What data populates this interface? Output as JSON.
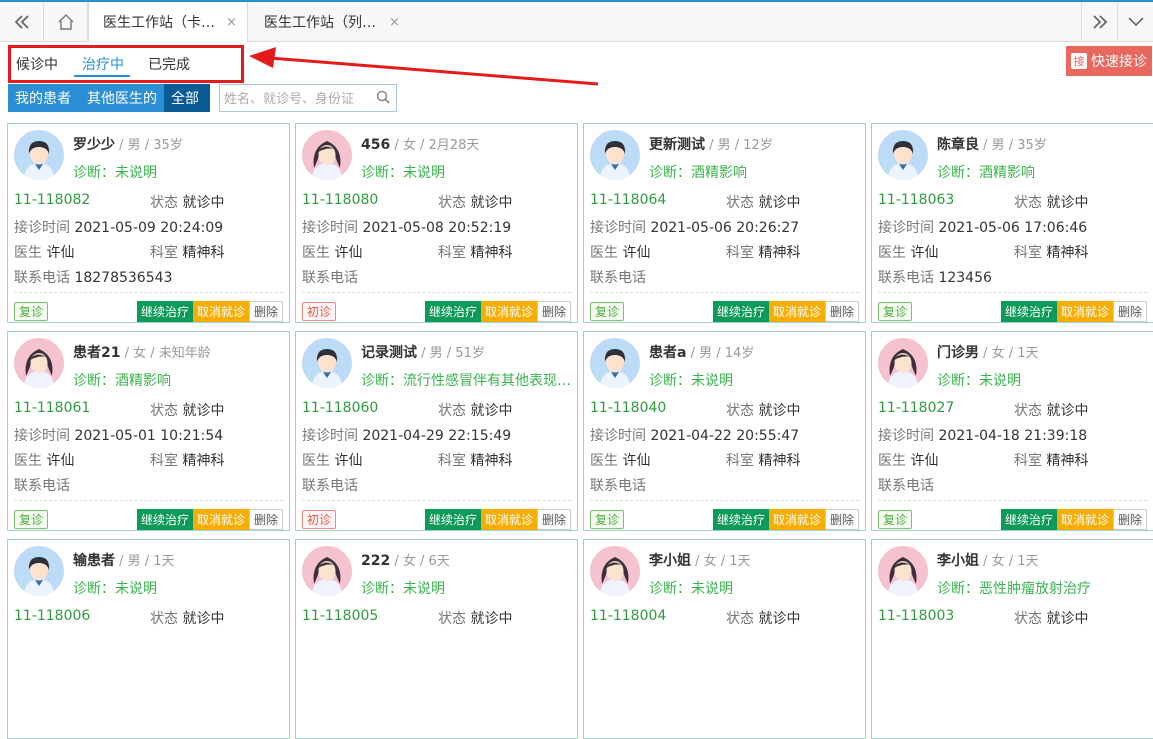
{
  "topbar": {
    "back_icon": "double-chevron-left-icon",
    "home_icon": "home-icon",
    "tabs": [
      {
        "label": "医生工作站（卡…",
        "close": "×"
      },
      {
        "label": "医生工作站（列…",
        "close": "×"
      }
    ],
    "forward_icon": "double-chevron-right-icon",
    "menu_icon": "chevron-down-icon"
  },
  "status_tabs": [
    "候诊中",
    "治疗中",
    "已完成"
  ],
  "active_status": "治疗中",
  "quick_button": {
    "icon_char": "接",
    "label": "快速接诊"
  },
  "filters": [
    "我的患者",
    "其他医生的",
    "全部"
  ],
  "search": {
    "placeholder": "姓名、就诊号、身份证",
    "value": ""
  },
  "labels": {
    "status": "状态",
    "time": "接诊时间",
    "doctor": "医生",
    "dept": "科室",
    "phone": "联系电话",
    "continue": "继续治疗",
    "cancel": "取消就诊",
    "delete": "删除"
  },
  "colors": {
    "accent": "#2b8fd6",
    "continue": "#0b9a58",
    "cancel": "#f6ad05",
    "quick": "#e9685e",
    "highlight": "#e51b1b"
  },
  "patients": [
    {
      "name": "罗少少",
      "meta": " / 男 / 35岁",
      "gender": "male",
      "diag": "诊断：未说明",
      "id": "11-118082",
      "status": "就诊中",
      "time": "2021-05-09 20:24:09",
      "doctor": "许仙",
      "dept": "精神科",
      "phone": "18278536543",
      "badge": "复诊",
      "badge_type": "fu"
    },
    {
      "name": "456",
      "meta": " / 女 / 2月28天",
      "gender": "female",
      "diag": "诊断：未说明",
      "id": "11-118080",
      "status": "就诊中",
      "time": "2021-05-08 20:52:19",
      "doctor": "许仙",
      "dept": "精神科",
      "phone": "",
      "badge": "初诊",
      "badge_type": "chu"
    },
    {
      "name": "更新测试",
      "meta": " / 男 / 12岁",
      "gender": "male",
      "diag": "诊断：酒精影响",
      "id": "11-118064",
      "status": "就诊中",
      "time": "2021-05-06 20:26:27",
      "doctor": "许仙",
      "dept": "精神科",
      "phone": "",
      "badge": "复诊",
      "badge_type": "fu"
    },
    {
      "name": "陈章良",
      "meta": " / 男 / 35岁",
      "gender": "male",
      "diag": "诊断：酒精影响",
      "id": "11-118063",
      "status": "就诊中",
      "time": "2021-05-06 17:06:46",
      "doctor": "许仙",
      "dept": "精神科",
      "phone": "123456",
      "badge": "复诊",
      "badge_type": "fu"
    },
    {
      "name": "患者21",
      "meta": " / 女 / 未知年龄",
      "gender": "female",
      "diag": "诊断：酒精影响",
      "id": "11-118061",
      "status": "就诊中",
      "time": "2021-05-01 10:21:54",
      "doctor": "许仙",
      "dept": "精神科",
      "phone": "",
      "badge": "复诊",
      "badge_type": "fu"
    },
    {
      "name": "记录测试",
      "meta": " / 男 / 51岁",
      "gender": "male",
      "diag": "诊断：流行性感冒伴有其他表现…",
      "id": "11-118060",
      "status": "就诊中",
      "time": "2021-04-29 22:15:49",
      "doctor": "许仙",
      "dept": "精神科",
      "phone": "",
      "badge": "初诊",
      "badge_type": "chu"
    },
    {
      "name": "患者a",
      "meta": " / 男 / 14岁",
      "gender": "male",
      "diag": "诊断：未说明",
      "id": "11-118040",
      "status": "就诊中",
      "time": "2021-04-22 20:55:47",
      "doctor": "许仙",
      "dept": "精神科",
      "phone": "",
      "badge": "复诊",
      "badge_type": "fu"
    },
    {
      "name": "门诊男",
      "meta": " / 女 / 1天",
      "gender": "female",
      "diag": "诊断：未说明",
      "id": "11-118027",
      "status": "就诊中",
      "time": "2021-04-18 21:39:18",
      "doctor": "许仙",
      "dept": "精神科",
      "phone": "",
      "badge": "复诊",
      "badge_type": "fu"
    },
    {
      "name": "输患者",
      "meta": " / 男 / 1天",
      "gender": "male",
      "diag": "诊断：未说明",
      "id": "11-118006",
      "status": "就诊中",
      "time": "",
      "doctor": "",
      "dept": "",
      "phone": "",
      "badge": "",
      "badge_type": "fu"
    },
    {
      "name": "222",
      "meta": " / 女 / 6天",
      "gender": "female",
      "diag": "诊断：未说明",
      "id": "11-118005",
      "status": "就诊中",
      "time": "",
      "doctor": "",
      "dept": "",
      "phone": "",
      "badge": "",
      "badge_type": "fu"
    },
    {
      "name": "李小姐",
      "meta": " / 女 / 1天",
      "gender": "female",
      "diag": "诊断：未说明",
      "id": "11-118004",
      "status": "就诊中",
      "time": "",
      "doctor": "",
      "dept": "",
      "phone": "",
      "badge": "",
      "badge_type": "fu"
    },
    {
      "name": "李小姐",
      "meta": " / 女 / 1天",
      "gender": "female",
      "diag": "诊断：恶性肿瘤放射治疗",
      "id": "11-118003",
      "status": "就诊中",
      "time": "",
      "doctor": "",
      "dept": "",
      "phone": "",
      "badge": "",
      "badge_type": "fu"
    }
  ]
}
